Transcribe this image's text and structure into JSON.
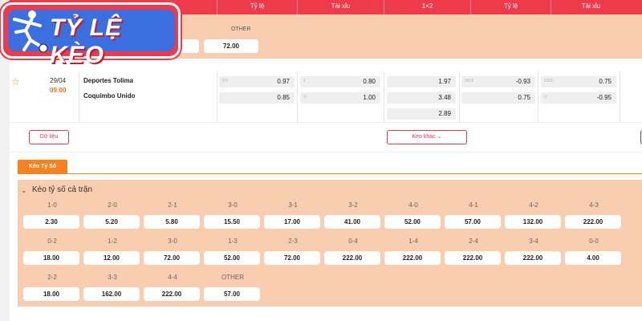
{
  "logo": {
    "text": "TỶ LỆ KÈO"
  },
  "header": {
    "cols": [
      "Tỷ lệ",
      "Tài xỉu",
      "1×2",
      "Tỷ lệ",
      "Tài xỉu"
    ]
  },
  "prev_block": {
    "other_label": "OTHER",
    "other_value": "72.00"
  },
  "match": {
    "date": "29/04",
    "time": "09:00",
    "home": "Deportes Tolima",
    "away": "Coquimbo Unido",
    "odds": {
      "ft_handicap": [
        {
          "lbl": "0.5",
          "val": "0.97"
        },
        {
          "lbl": "",
          "val": "0.85"
        }
      ],
      "ft_ou": [
        {
          "lbl": "2",
          "val": "0.80"
        },
        {
          "lbl": "U",
          "val": "1.00"
        }
      ],
      "ft_1x2": [
        "1.97",
        "3.48",
        "2.89"
      ],
      "h1_handicap": [
        {
          "lbl": "0/0.5",
          "val": "-0.93"
        },
        {
          "lbl": "",
          "val": "0.75"
        }
      ],
      "h1_ou": [
        {
          "lbl": "0.5/1",
          "val": "0.75"
        },
        {
          "lbl": "U",
          "val": "-0.95"
        }
      ]
    },
    "data_button": "Dữ liệu",
    "more_button": "Kèo khác"
  },
  "tab": {
    "label": "Kèo Tỷ Số"
  },
  "score_section": {
    "title": "Kèo tỷ số cả trận",
    "rows": [
      [
        {
          "s": "1-0",
          "o": "2.30"
        },
        {
          "s": "2-0",
          "o": "5.20"
        },
        {
          "s": "2-1",
          "o": "5.80"
        },
        {
          "s": "3-0",
          "o": "15.50"
        },
        {
          "s": "3-1",
          "o": "17.00"
        },
        {
          "s": "3-2",
          "o": "41.00"
        },
        {
          "s": "4-0",
          "o": "52.00"
        },
        {
          "s": "4-1",
          "o": "57.00"
        },
        {
          "s": "4-2",
          "o": "132.00"
        },
        {
          "s": "4-3",
          "o": "222.00"
        }
      ],
      [
        {
          "s": "0-2",
          "o": "18.00"
        },
        {
          "s": "1-2",
          "o": "12.00"
        },
        {
          "s": "3-0",
          "o": "72.00"
        },
        {
          "s": "1-3",
          "o": "52.00"
        },
        {
          "s": "2-3",
          "o": "72.00"
        },
        {
          "s": "0-4",
          "o": "222.00"
        },
        {
          "s": "1-4",
          "o": "222.00"
        },
        {
          "s": "2-4",
          "o": "222.00"
        },
        {
          "s": "3-4",
          "o": "222.00"
        },
        {
          "s": "0-0",
          "o": "4.00"
        }
      ],
      [
        {
          "s": "2-2",
          "o": "18.00"
        },
        {
          "s": "3-3",
          "o": "162.00"
        },
        {
          "s": "4-4",
          "o": "222.00"
        },
        {
          "s": "OTHER",
          "o": "57.00"
        }
      ]
    ]
  }
}
